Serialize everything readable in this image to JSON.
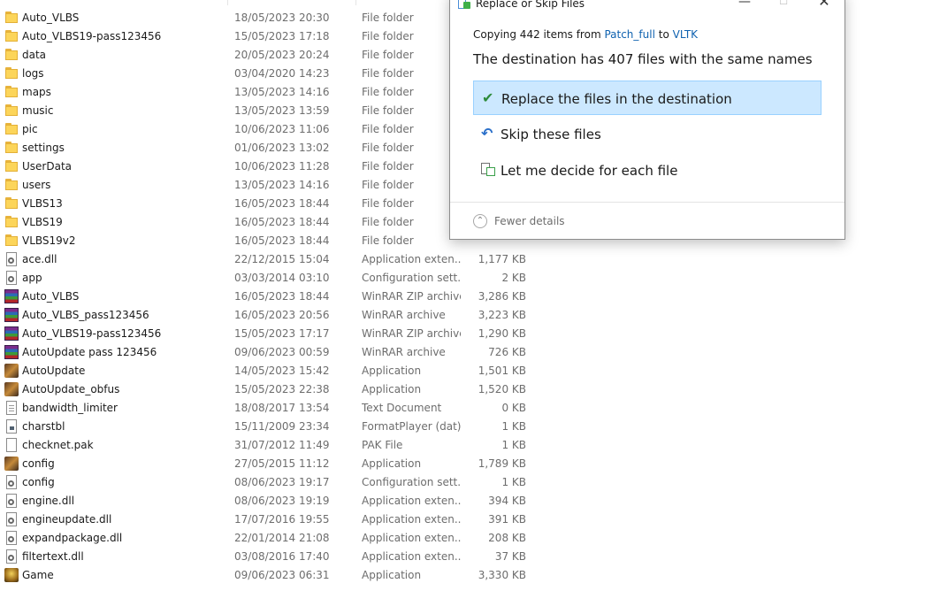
{
  "files": [
    {
      "name": "Auto_VLBS",
      "date": "18/05/2023 20:30",
      "type": "File folder",
      "size": "",
      "icon": "folder-icon"
    },
    {
      "name": "Auto_VLBS19-pass123456",
      "date": "15/05/2023 17:18",
      "type": "File folder",
      "size": "",
      "icon": "folder-icon"
    },
    {
      "name": "data",
      "date": "20/05/2023 20:24",
      "type": "File folder",
      "size": "",
      "icon": "folder-icon"
    },
    {
      "name": "logs",
      "date": "03/04/2020 14:23",
      "type": "File folder",
      "size": "",
      "icon": "folder-icon"
    },
    {
      "name": "maps",
      "date": "13/05/2023 14:16",
      "type": "File folder",
      "size": "",
      "icon": "folder-icon"
    },
    {
      "name": "music",
      "date": "13/05/2023 13:59",
      "type": "File folder",
      "size": "",
      "icon": "folder-icon"
    },
    {
      "name": "pic",
      "date": "10/06/2023 11:06",
      "type": "File folder",
      "size": "",
      "icon": "folder-icon"
    },
    {
      "name": "settings",
      "date": "01/06/2023 13:02",
      "type": "File folder",
      "size": "",
      "icon": "folder-icon"
    },
    {
      "name": "UserData",
      "date": "10/06/2023 11:28",
      "type": "File folder",
      "size": "",
      "icon": "folder-icon"
    },
    {
      "name": "users",
      "date": "13/05/2023 14:16",
      "type": "File folder",
      "size": "",
      "icon": "folder-icon"
    },
    {
      "name": "VLBS13",
      "date": "16/05/2023 18:44",
      "type": "File folder",
      "size": "",
      "icon": "folder-icon"
    },
    {
      "name": "VLBS19",
      "date": "16/05/2023 18:44",
      "type": "File folder",
      "size": "",
      "icon": "folder-icon"
    },
    {
      "name": "VLBS19v2",
      "date": "16/05/2023 18:44",
      "type": "File folder",
      "size": "",
      "icon": "folder-icon"
    },
    {
      "name": "ace.dll",
      "date": "22/12/2015 15:04",
      "type": "Application exten...",
      "size": "1,177 KB",
      "icon": "dll-icon"
    },
    {
      "name": "app",
      "date": "03/03/2014 03:10",
      "type": "Configuration sett...",
      "size": "2 KB",
      "icon": "config-icon"
    },
    {
      "name": "Auto_VLBS",
      "date": "16/05/2023 18:44",
      "type": "WinRAR ZIP archive",
      "size": "3,286 KB",
      "icon": "winrar-icon"
    },
    {
      "name": "Auto_VLBS_pass123456",
      "date": "16/05/2023 20:56",
      "type": "WinRAR archive",
      "size": "3,223 KB",
      "icon": "winrar-icon"
    },
    {
      "name": "Auto_VLBS19-pass123456",
      "date": "15/05/2023 17:17",
      "type": "WinRAR ZIP archive",
      "size": "1,290 KB",
      "icon": "winrar-icon"
    },
    {
      "name": "AutoUpdate pass 123456",
      "date": "09/06/2023 00:59",
      "type": "WinRAR archive",
      "size": "726 KB",
      "icon": "winrar-icon"
    },
    {
      "name": "AutoUpdate",
      "date": "14/05/2023 15:42",
      "type": "Application",
      "size": "1,501 KB",
      "icon": "app-icon"
    },
    {
      "name": "AutoUpdate_obfus",
      "date": "15/05/2023 22:38",
      "type": "Application",
      "size": "1,520 KB",
      "icon": "app-icon"
    },
    {
      "name": "bandwidth_limiter",
      "date": "18/08/2017 13:54",
      "type": "Text Document",
      "size": "0 KB",
      "icon": "text-doc-icon"
    },
    {
      "name": "charstbl",
      "date": "15/11/2009 23:34",
      "type": "FormatPlayer (dat)",
      "size": "1 KB",
      "icon": "dat-file-icon"
    },
    {
      "name": "checknet.pak",
      "date": "31/07/2012 11:49",
      "type": "PAK File",
      "size": "1 KB",
      "icon": "blank-file-icon"
    },
    {
      "name": "config",
      "date": "27/05/2015 11:12",
      "type": "Application",
      "size": "1,789 KB",
      "icon": "app-icon"
    },
    {
      "name": "config",
      "date": "08/06/2023 19:17",
      "type": "Configuration sett...",
      "size": "1 KB",
      "icon": "config-icon"
    },
    {
      "name": "engine.dll",
      "date": "08/06/2023 19:19",
      "type": "Application exten...",
      "size": "394 KB",
      "icon": "dll-icon"
    },
    {
      "name": "engineupdate.dll",
      "date": "17/07/2016 19:55",
      "type": "Application exten...",
      "size": "391 KB",
      "icon": "dll-icon"
    },
    {
      "name": "expandpackage.dll",
      "date": "22/01/2014 21:08",
      "type": "Application exten...",
      "size": "208 KB",
      "icon": "dll-icon"
    },
    {
      "name": "filtertext.dll",
      "date": "03/08/2016 17:40",
      "type": "Application exten...",
      "size": "37 KB",
      "icon": "dll-icon"
    },
    {
      "name": "Game",
      "date": "09/06/2023 06:31",
      "type": "Application",
      "size": "3,330 KB",
      "icon": "game-app-icon"
    }
  ],
  "dialog": {
    "title": "Replace or Skip Files",
    "copy_prefix": "Copying 442 items from ",
    "source": "Patch_full",
    "copy_mid": " to ",
    "destination": "VLTK",
    "heading": "The destination has 407 files with the same names",
    "option_replace": "Replace the files in the destination",
    "option_skip": "Skip these files",
    "option_decide": "Let me decide for each file",
    "fewer_details": "Fewer details",
    "min_glyph": "—",
    "max_glyph": "☐",
    "close_glyph": "✕",
    "replace_glyph": "✔",
    "skip_glyph": "↶",
    "fewer_glyph": "⌃",
    "accent_color": "#cce8ff",
    "link_color": "#0f62b0"
  }
}
